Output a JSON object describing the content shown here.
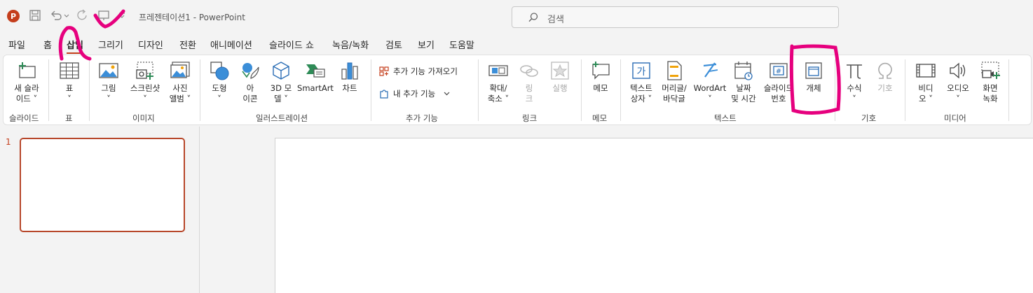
{
  "titlebar": {
    "app_logo": "P",
    "doc_title": "프레젠테이션1  -  PowerPoint",
    "search_placeholder": "검색",
    "icons": [
      "save-icon",
      "undo-icon",
      "redo-icon",
      "present-icon",
      "customize-icon"
    ]
  },
  "tabs": [
    {
      "label": "파일"
    },
    {
      "label": "홈"
    },
    {
      "label": "삽입"
    },
    {
      "label": "그리기"
    },
    {
      "label": "디자인"
    },
    {
      "label": "전환"
    },
    {
      "label": "애니메이션"
    },
    {
      "label": "슬라이드 쇼"
    },
    {
      "label": "녹음/녹화"
    },
    {
      "label": "검토"
    },
    {
      "label": "보기"
    },
    {
      "label": "도움말"
    }
  ],
  "active_tab": "삽입",
  "ribbon": {
    "groups": {
      "slides": "슬라이드",
      "table": "표",
      "images": "이미지",
      "illustrations": "일러스트레이션",
      "addins": "추가 기능",
      "links": "링크",
      "comments": "메모",
      "text": "텍스트",
      "symbols": "기호",
      "media": "미디어"
    },
    "buttons": {
      "new_slide": "새 슬라\n이드 ˅",
      "table": "표\n˅",
      "picture": "그림\n˅",
      "screenshot": "스크린샷\n˅",
      "photo_album": "사진\n앨범 ˅",
      "shapes": "도형\n˅",
      "icons": "아\n이콘",
      "models_3d": "3D 모\n델 ˅",
      "smartart": "SmartArt",
      "chart": "차트",
      "get_addins": "추가 기능 가져오기",
      "my_addins": "내 추가 기능",
      "zoom": "확대/\n축소 ˅",
      "link": "링\n크",
      "action": "실행",
      "comment": "메모",
      "textbox": "텍스트\n상자 ˅",
      "header_footer": "머리글/\n바닥글",
      "wordart": "WordArt\n˅",
      "date_time": "날짜\n및 시간",
      "slide_number": "슬라이드\n번호",
      "object": "개체",
      "equation": "수식\n˅",
      "symbol": "기호",
      "video": "비디\n오 ˅",
      "audio": "오디오\n˅",
      "screen_recording": "화면\n녹화"
    }
  },
  "slides": {
    "number": "1"
  },
  "colors": {
    "accent": "#c43e1c",
    "annotation": "#e6007e"
  }
}
